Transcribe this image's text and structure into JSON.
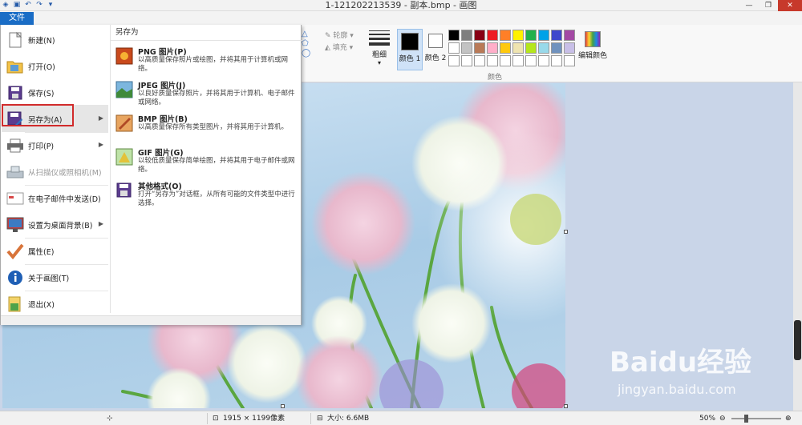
{
  "window": {
    "title": "1-121202213539 - 副本.bmp - 画图"
  },
  "ribbon": {
    "file_tab": "文件",
    "outline_label": "轮廓",
    "fill_label": "填充",
    "thickness_label": "粗细",
    "color1_label": "颜色 1",
    "color2_label": "颜色 2",
    "colors_group_label": "颜色",
    "edit_colors_label": "编辑颜色",
    "color1_value": "#000000",
    "color2_value": "#ffffff",
    "palette": [
      "#000000",
      "#7f7f7f",
      "#880015",
      "#ed1c24",
      "#ff7f27",
      "#fff200",
      "#22b14c",
      "#00a2e8",
      "#3f48cc",
      "#a349a4",
      "#ffffff",
      "#c3c3c3",
      "#b97a57",
      "#ffaec9",
      "#ffc90e",
      "#efe4b0",
      "#b5e61d",
      "#99d9ea",
      "#7092be",
      "#c8bfe7",
      "#ffffff",
      "#ffffff",
      "#ffffff",
      "#ffffff",
      "#ffffff",
      "#ffffff",
      "#ffffff",
      "#ffffff",
      "#ffffff",
      "#ffffff"
    ]
  },
  "file_menu": {
    "items": [
      {
        "label": "新建(N)",
        "icon": "new-document-icon"
      },
      {
        "label": "打开(O)",
        "icon": "open-folder-icon"
      },
      {
        "label": "保存(S)",
        "icon": "save-icon"
      },
      {
        "label": "另存为(A)",
        "icon": "save-as-icon"
      },
      {
        "label": "打印(P)",
        "icon": "printer-icon"
      },
      {
        "label": "从扫描仪或照相机(M)",
        "icon": "scanner-icon"
      },
      {
        "label": "在电子邮件中发送(D)",
        "icon": "email-icon"
      },
      {
        "label": "设置为桌面背景(B)",
        "icon": "desktop-background-icon"
      },
      {
        "label": "属性(E)",
        "icon": "properties-checkmark-icon"
      },
      {
        "label": "关于画图(T)",
        "icon": "info-icon"
      },
      {
        "label": "退出(X)",
        "icon": "exit-icon"
      }
    ],
    "save_as_panel": {
      "heading": "另存为",
      "items": [
        {
          "title": "PNG 图片(P)",
          "desc": "以高质量保存照片或绘图，并将其用于计算机或网络。",
          "icon": "png-image-icon"
        },
        {
          "title": "JPEG 图片(J)",
          "desc": "以良好质量保存照片，并将其用于计算机、电子邮件或网络。",
          "icon": "jpeg-image-icon"
        },
        {
          "title": "BMP 图片(B)",
          "desc": "以高质量保存所有类型图片，并将其用于计算机。",
          "icon": "bmp-image-icon"
        },
        {
          "title": "GIF 图片(G)",
          "desc": "以较低质量保存简单绘图，并将其用于电子邮件或网络。",
          "icon": "gif-image-icon"
        },
        {
          "title": "其他格式(O)",
          "desc": "打开“另存为”对话框，从所有可能的文件类型中进行选择。",
          "icon": "other-formats-icon"
        }
      ]
    }
  },
  "statusbar": {
    "dimensions": "1915 × 1199像素",
    "size": "大小: 6.6MB",
    "zoom": "50%",
    "zoom_fraction": 0.5
  },
  "watermark": {
    "brand": "Baidu经验",
    "url": "jingyan.baidu.com"
  }
}
